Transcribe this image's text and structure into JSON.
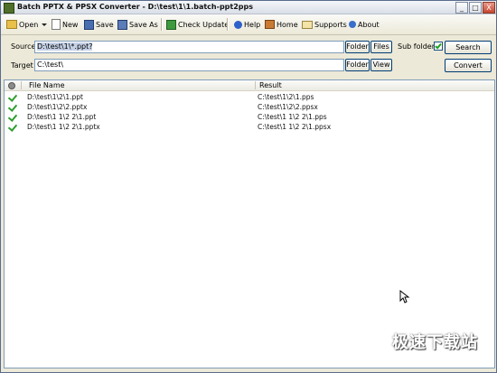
{
  "window": {
    "title": "Batch PPTX & PPSX Converter - D:\\test\\1\\1.batch-ppt2pps",
    "minimize_glyph": "_",
    "maximize_glyph": "□",
    "close_glyph": "X"
  },
  "toolbar": {
    "open": "Open",
    "new": "New",
    "save": "Save",
    "save_as": "Save As",
    "check_update": "Check Update",
    "help": "Help",
    "home": "Home",
    "supports": "Supports",
    "about": "About"
  },
  "source": {
    "label": "Source",
    "value": "D:\\test\\1\\*.ppt?",
    "folder_button": "Folder",
    "files_button": "Files",
    "subfolders_label": "Sub folders",
    "subfolders_checked": true,
    "search_button": "Search"
  },
  "target": {
    "label": "Target",
    "value": "C:\\test\\",
    "folder_button": "Folder",
    "view_button": "View",
    "convert_button": "Convert"
  },
  "grid": {
    "columns": [
      "File Name",
      "Result"
    ],
    "rows": [
      {
        "file": "D:\\test\\1\\2\\1.ppt",
        "result": "C:\\test\\1\\2\\1.pps"
      },
      {
        "file": "D:\\test\\1\\2\\2.pptx",
        "result": "C:\\test\\1\\2\\2.ppsx"
      },
      {
        "file": "D:\\test\\1 1\\2 2\\1.ppt",
        "result": "C:\\test\\1 1\\2 2\\1.pps"
      },
      {
        "file": "D:\\test\\1 1\\2 2\\1.pptx",
        "result": "C:\\test\\1 1\\2 2\\1.ppsx"
      }
    ]
  },
  "watermark": "极速下载站",
  "colors": {
    "check_green": "#2e9e2e",
    "window_bg": "#ece9d8"
  }
}
